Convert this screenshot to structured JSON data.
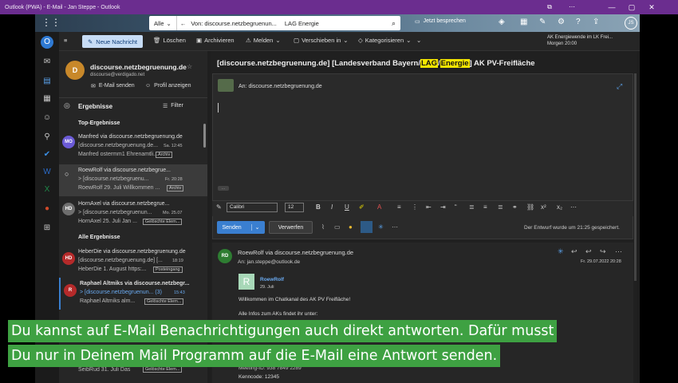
{
  "window": {
    "title": "Outlook (PWA) - E-Mail - Jan Steppe - Outlook",
    "min": "—",
    "max": "▢",
    "close": "✕"
  },
  "search": {
    "scope": "Alle",
    "query": "Von: discourse.netzbegruenun...",
    "extra": "LAG Energie"
  },
  "topbar": {
    "meeting": "Jetzt besprechen",
    "user_initials": "JS"
  },
  "ribbon": {
    "new_mail": "Neue Nachricht",
    "delete": "Löschen",
    "archive": "Archivieren",
    "report": "Melden",
    "move": "Verschieben in",
    "categorize": "Kategorisieren",
    "reminder_title": "AK Energiewende im LK Frei...",
    "reminder_time": "Morgen 20:00"
  },
  "contact": {
    "initial": "D",
    "name": "discourse.netzbegruenung.de",
    "address": "discourse@verdigado.net",
    "send_mail": "E-Mail senden",
    "profile": "Profil anzeigen"
  },
  "results": {
    "title": "Ergebnisse",
    "filter": "Filter",
    "top_header": "Top-Ergebnisse",
    "all_header": "Alle Ergebnisse"
  },
  "items": [
    {
      "initials": "MO",
      "color": "#6b5bd6",
      "from": "Manfred via discourse.netzbegruenung.de",
      "subject": "[discourse.netzbegruenung.de...",
      "date": "Sa. 12:45",
      "preview": "Manfred ostermm1 Ehrenamtli...",
      "chip": "Archiv"
    },
    {
      "initials": "",
      "color": "#2b2b2b",
      "from": "RoewRolf via discourse.netzbegrue...",
      "subject": "> [discourse.netzbegruenu...",
      "date": "Fr. 20:28",
      "preview": "RoewRolf 29. Juli Willkommen ...",
      "chip": "Archiv"
    },
    {
      "initials": "HD",
      "color": "#6e6e6e",
      "from": "HornAxel via discourse.netzbegrue...",
      "subject": "> [discourse.netzbegruenun...",
      "date": "Mo. 25.07",
      "preview": "HornAxel 25. Juli Jan ...",
      "chip": "Gelöschte Elem..."
    },
    {
      "initials": "HD",
      "color": "#b52a2a",
      "from": "HeberDie via discourse.netzbegruenung.de",
      "subject": "[discourse.netzbegruenung.de] [...",
      "date": "18:19",
      "preview": "HeberDie 1. August https:...",
      "chip": "Posteingang"
    },
    {
      "initials": "R",
      "color": "#b52a2a",
      "from": "Raphael Altmiks via discourse.netzbegr...",
      "subject": "> [discourse.netzbegruenun... (3)",
      "date": "15:43",
      "preview": "Raphael Altmiks alm...",
      "chip": "Gelöschte Elem..."
    },
    {
      "initials": "",
      "color": "#2b2b2b",
      "from": "",
      "subject": "",
      "date": "",
      "preview": "SeibRud 31. Juli Das",
      "chip": "Gelöschte Elem..."
    }
  ],
  "reading": {
    "subject_pre": "[discourse.netzbegruenung.de] [Landesverband Bayern/",
    "hl1": "LAG",
    "hl2": "Energie",
    "subject_post": "] AK PV-Freifläche",
    "to_label": "An:",
    "to": "discourse.netzbegruenung.de",
    "font": "Calibri",
    "size": "12",
    "send": "Senden",
    "discard": "Verwerfen",
    "draft_saved": "Der Entwurf wurde um 21:25 gespeichert."
  },
  "message": {
    "initials": "RD",
    "from": "RoewRolf via discourse.netzbegruenung.de",
    "to_label": "An:",
    "to": "jan.steppe@outlook.de",
    "date": "Fr. 29.07.2022 20:28",
    "card_name": "RoewRolf",
    "card_date": "29. Juli",
    "line1": "Willkommen im Chatkanal des AK PV Freifläche!",
    "line2": "Alle Infos zum AKs findet ihr unter:",
    "line3": "Meeting-ID: 938 7849 2289",
    "line4": "Kenncode: 12345"
  },
  "captions": {
    "line1": "Du kannst auf E-Mail Benachrichtigungen auch direkt antworten. Dafür musst",
    "line2": "Du nur in Deinem Mail Programm auf die E-Mail eine Antwort senden."
  },
  "colors": {
    "accent": "#3a7fd0",
    "highlight": "#f5e600",
    "caption_bg": "#3ea142",
    "titlebar": "#6b2d8f"
  }
}
